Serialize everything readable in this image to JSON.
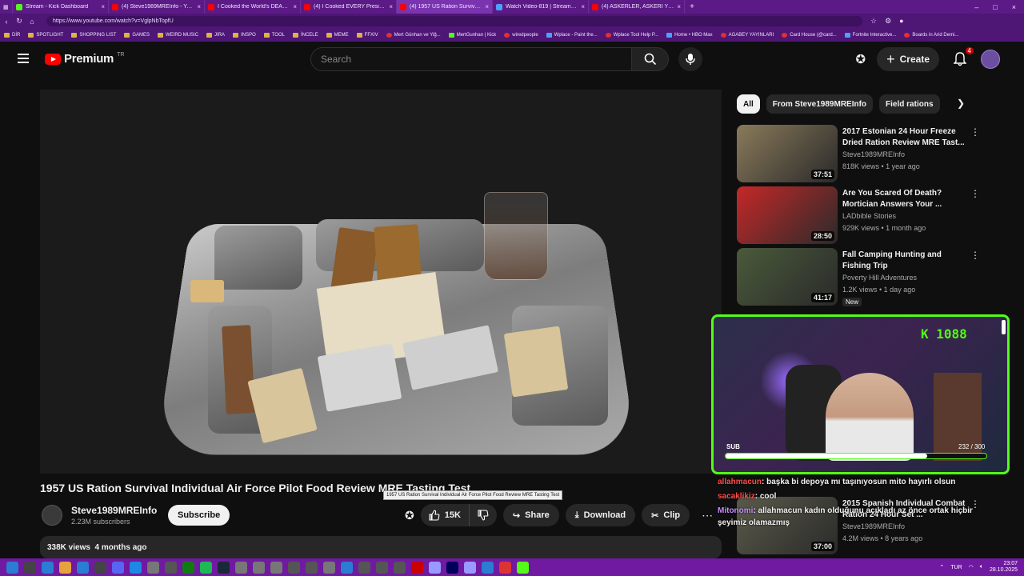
{
  "browser": {
    "tabs": [
      {
        "label": "Stream - Kick Dashboard",
        "color": "#53fc18"
      },
      {
        "label": "(4) Steve1989MREInfo - YouTube",
        "color": "#ff0000"
      },
      {
        "label": "I Cooked the World's DEADLIEST",
        "color": "#ff0000"
      },
      {
        "label": "(4) I Cooked EVERY President's Fa",
        "color": "#ff0000"
      },
      {
        "label": "(4) 1957 US Ration Survival I",
        "color": "#ff0000"
      },
      {
        "label": "Watch Video-819 | Streamable",
        "color": "#4ea0ff"
      },
      {
        "label": "(4) ASKERLER, ASKERİ YEMEKLER",
        "color": "#ff0000"
      }
    ],
    "url": "https://www.youtube.com/watch?v=VglpNbTopfU",
    "bookmarks": [
      {
        "label": "DİR",
        "kind": "folder"
      },
      {
        "label": "SPOTLIGHT",
        "kind": "folder"
      },
      {
        "label": "SHOPPING LIST",
        "kind": "folder"
      },
      {
        "label": "GAMES",
        "kind": "folder"
      },
      {
        "label": "WEIRD MUSIC",
        "kind": "folder"
      },
      {
        "label": "JIRA",
        "kind": "folder"
      },
      {
        "label": "INSPO",
        "kind": "folder"
      },
      {
        "label": "TOOL",
        "kind": "folder"
      },
      {
        "label": "İNCELE",
        "kind": "folder"
      },
      {
        "label": "MEME",
        "kind": "folder"
      },
      {
        "label": "FFXIV",
        "kind": "folder"
      },
      {
        "label": "Mert Günhan ve Yiğ...",
        "kind": "red"
      },
      {
        "label": "MertGunhan | Kick",
        "kind": "green"
      },
      {
        "label": "wiredpeople",
        "kind": "red"
      },
      {
        "label": "Wplace - Paint the...",
        "kind": "blue"
      },
      {
        "label": "Wplace Tool Help P...",
        "kind": "red"
      },
      {
        "label": "Home • HBO Max",
        "kind": "blue"
      },
      {
        "label": "AGABEY YAYINLARI",
        "kind": "red"
      },
      {
        "label": "Card House (@card...",
        "kind": "red"
      },
      {
        "label": "Fortnite Interactive...",
        "kind": "blue"
      },
      {
        "label": "Boards in Arid Demi...",
        "kind": "red"
      }
    ]
  },
  "header": {
    "logo_text": "Premium",
    "logo_region": "TR",
    "search_placeholder": "Search",
    "create_label": "Create",
    "notif_count": "4"
  },
  "video": {
    "title": "1957 US Ration Survival Individual Air Force Pilot Food Review MRE Tasting Test",
    "tooltip": "1957 US Ration Survival Individual Air Force Pilot Food Review MRE Tasting Test",
    "channel": "Steve1989MREInfo",
    "subscribers": "2.23M subscribers",
    "subscribe_label": "Subscribe",
    "likes": "15K",
    "share_label": "Share",
    "download_label": "Download",
    "clip_label": "Clip",
    "views_date": "338K views  4 months ago"
  },
  "chips": [
    "All",
    "From Steve1989MREInfo",
    "Field rations"
  ],
  "recommendations": [
    {
      "title": "2017 Estonian 24 Hour Freeze Dried Ration Review MRE Tast...",
      "channel": "Steve1989MREInfo",
      "meta": "818K views • 1 year ago",
      "duration": "37:51",
      "thumb": "#8a7a5a"
    },
    {
      "title": "Are You Scared Of Death? Mortician Answers Your ...",
      "channel": "LADbible Stories",
      "meta": "929K views • 1 month ago",
      "duration": "28:50",
      "thumb": "#c62828"
    },
    {
      "title": "Fall Camping Hunting and Fishing Trip",
      "channel": "Poverty Hill Adventures",
      "meta": "1.2K views • 1 day ago",
      "duration": "41:17",
      "thumb": "#4a5a3a",
      "new": "New"
    },
    {
      "title": "2015 Spanish Individual Combat Ration 24 Hour Set ...",
      "channel": "Steve1989MREInfo",
      "meta": "4.2M views • 8 years ago",
      "duration": "37:00",
      "thumb": "#5a5a4a"
    }
  ],
  "stream": {
    "kick_count": "K 1088",
    "sub_label": "SUB",
    "sub_progress": "232 / 300",
    "sub_fraction": 0.773,
    "chat": [
      {
        "user": "allahmacun",
        "text": ": başka bi depoya mı taşınıyosun mito hayırlı olsun"
      },
      {
        "user": "sacaklikiz",
        "text": ": cool"
      },
      {
        "user": "Mitonomi",
        "text": ": allahmacun kadın olduğunu açıkladı az önce ortak hiçbir"
      },
      {
        "user": "",
        "text": "şeyimiz olamazmış"
      }
    ]
  },
  "taskbar": {
    "lang": "TUR",
    "time": "23:07",
    "date": "28.10.2025"
  }
}
